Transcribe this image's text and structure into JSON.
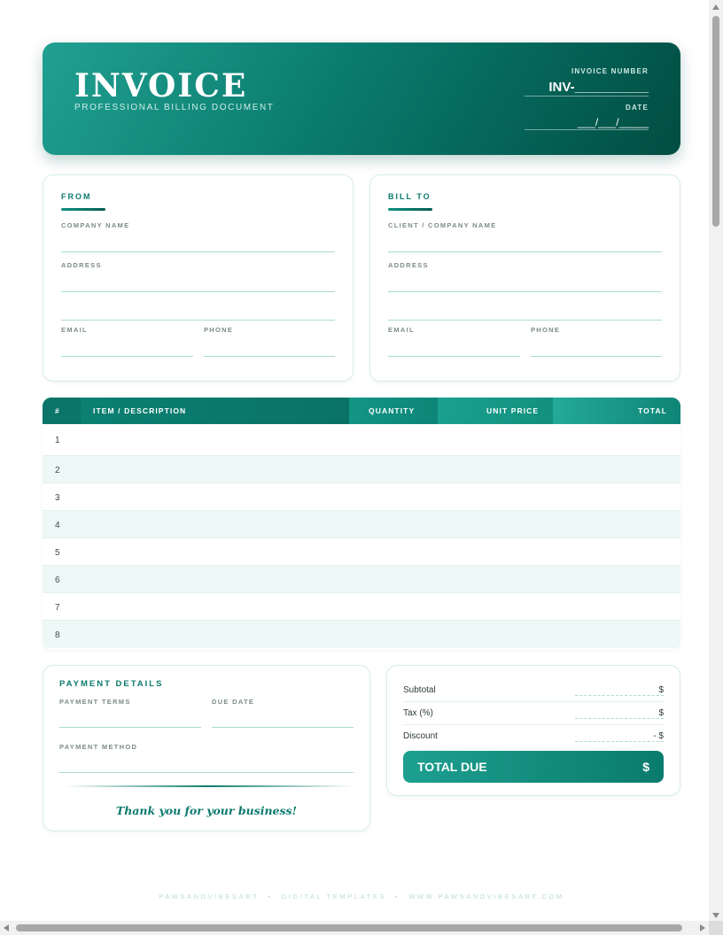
{
  "header": {
    "title": "INVOICE",
    "subtitle": "PROFESSIONAL BILLING DOCUMENT",
    "invoice_number_label": "INVOICE NUMBER",
    "invoice_number_value": "INV-__________",
    "date_label": "DATE",
    "date_value": "___/___/_____"
  },
  "from": {
    "title": "FROM",
    "company_label": "COMPANY NAME",
    "address_label": "ADDRESS",
    "email_label": "EMAIL",
    "phone_label": "PHONE"
  },
  "bill_to": {
    "title": "BILL TO",
    "company_label": "CLIENT / COMPANY NAME",
    "address_label": "ADDRESS",
    "email_label": "EMAIL",
    "phone_label": "PHONE"
  },
  "table": {
    "headers": [
      "#",
      "ITEM / DESCRIPTION",
      "QUANTITY",
      "UNIT PRICE",
      "TOTAL"
    ],
    "rows": [
      "1",
      "2",
      "3",
      "4",
      "5",
      "6",
      "7",
      "8"
    ]
  },
  "payment": {
    "title": "PAYMENT DETAILS",
    "terms_label": "PAYMENT TERMS",
    "due_label": "DUE DATE",
    "method_label": "PAYMENT METHOD",
    "thanks": "Thank you for your business!"
  },
  "summary": {
    "subtotal_label": "Subtotal",
    "subtotal_value": "$",
    "tax_label": "Tax (%)",
    "tax_value": "$",
    "discount_label": "Discount",
    "discount_value": "- $",
    "total_label": "TOTAL DUE",
    "total_value": "$"
  },
  "footer": {
    "brand": "PAWSANDVIBESART",
    "tagline": "DIGITAL TEMPLATES",
    "website": "WWW.PAWSANDVIBESART.COM"
  },
  "colors": {
    "accent": "#0b7a6d",
    "header_dark": "#014d42",
    "header_light": "#21a091",
    "row_alt": "#eef8f6"
  }
}
